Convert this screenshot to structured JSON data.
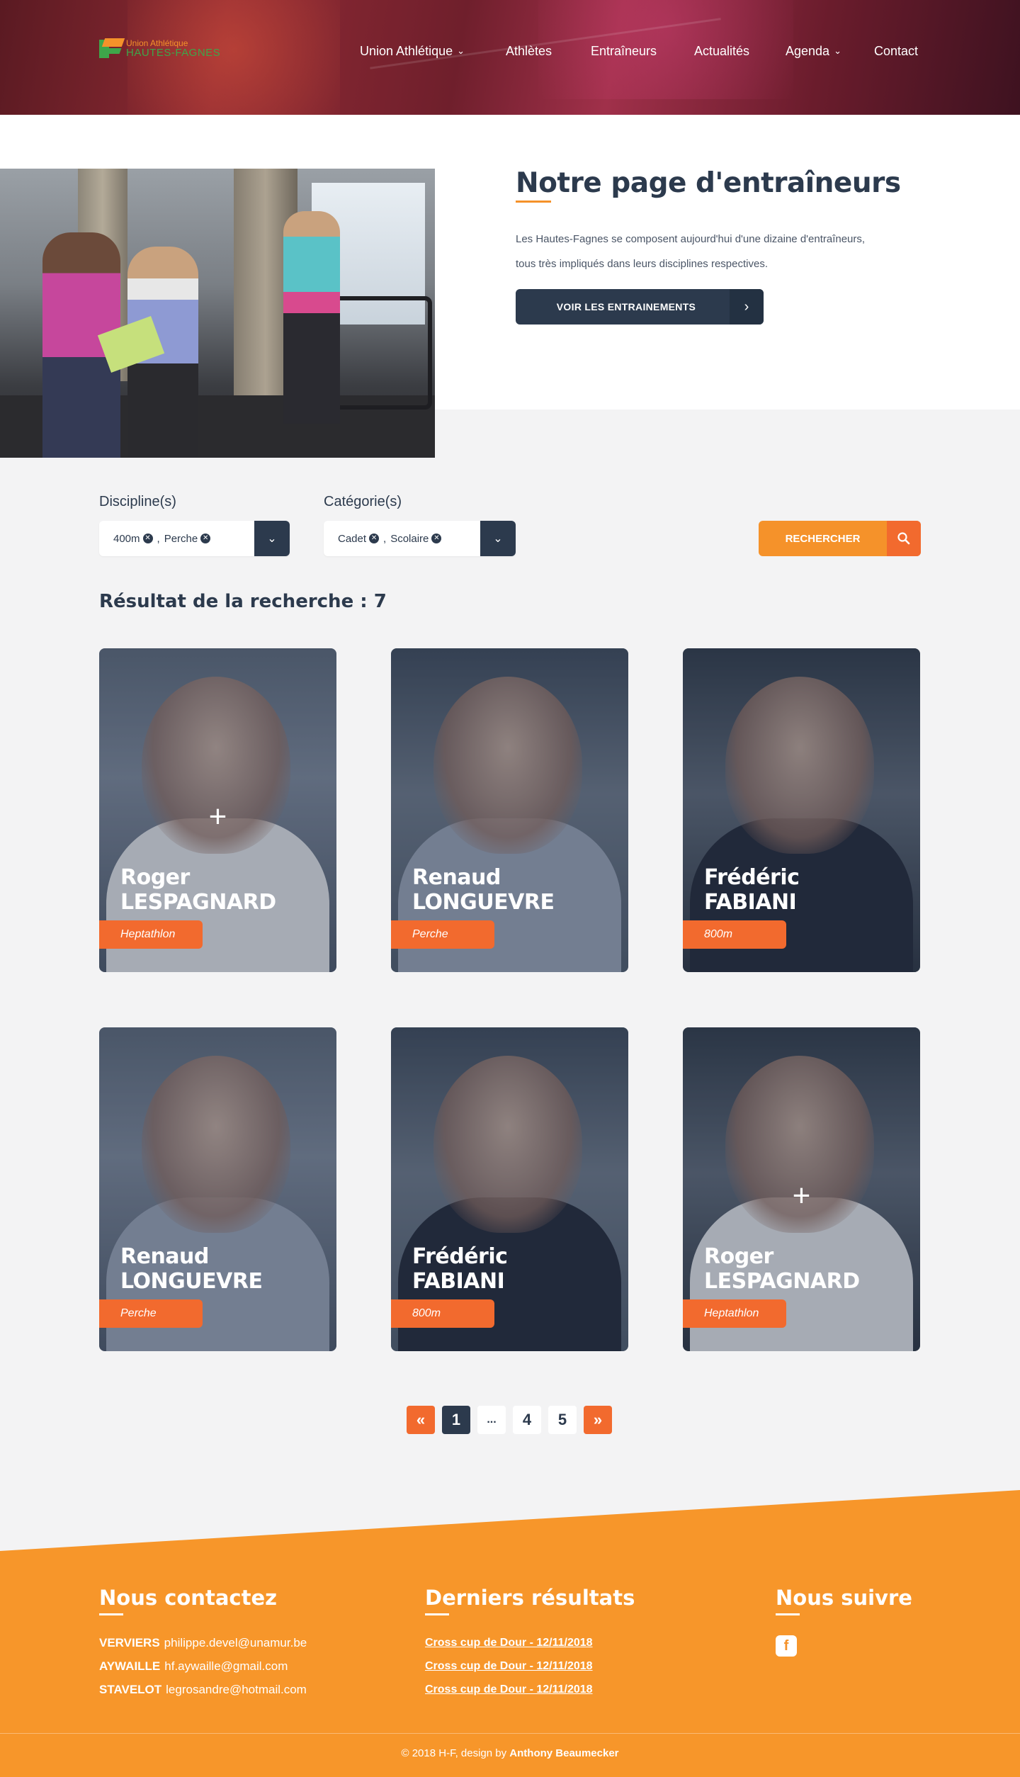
{
  "header": {
    "logo": {
      "line1": "Union Athlétique",
      "line2": "HAUTES-FAGNES"
    },
    "nav": [
      {
        "label": "Union Athlétique",
        "dropdown": true
      },
      {
        "label": "Athlètes",
        "dropdown": false
      },
      {
        "label": "Entraîneurs",
        "dropdown": false
      },
      {
        "label": "Actualités",
        "dropdown": false
      },
      {
        "label": "Agenda",
        "dropdown": true
      },
      {
        "label": "Contact",
        "dropdown": false
      }
    ]
  },
  "intro": {
    "title": "Notre page d'entraîneurs",
    "text_line1": "Les Hautes-Fagnes se composent aujourd'hui d'une dizaine d'entraîneurs,",
    "text_line2": "tous très impliqués dans leurs disciplines respectives.",
    "button_label": "VOIR LES  ENTRAINEMENTS"
  },
  "filters": {
    "discipline_label": "Discipline(s)",
    "discipline_tags": [
      "400m",
      "Perche"
    ],
    "category_label": "Catégorie(s)",
    "category_tags": [
      "Cadet",
      "Scolaire"
    ],
    "search_label": "RECHERCHER"
  },
  "results": {
    "label": "Résultat de la recherche : 7"
  },
  "cards": [
    {
      "first": "Roger",
      "last": "LESPAGNARD",
      "discipline": "Heptathlon",
      "hover": true,
      "shirt": "#e9e9ec"
    },
    {
      "first": "Renaud",
      "last": "LONGUEVRE",
      "discipline": "Perche",
      "hover": false,
      "shirt": "#9aa3b6"
    },
    {
      "first": "Frédéric",
      "last": "FABIANI",
      "discipline": "800m",
      "hover": false,
      "shirt": "#1d2130"
    },
    {
      "first": "Renaud",
      "last": "LONGUEVRE",
      "discipline": "Perche",
      "hover": false,
      "shirt": "#9aa3b6"
    },
    {
      "first": "Frédéric",
      "last": "FABIANI",
      "discipline": "800m",
      "hover": false,
      "shirt": "#1d2130"
    },
    {
      "first": "Roger",
      "last": "LESPAGNARD",
      "discipline": "Heptathlon",
      "hover": true,
      "shirt": "#e9e9ec"
    }
  ],
  "pagination": {
    "prev": "«",
    "pages": [
      "1",
      "...",
      "4",
      "5"
    ],
    "next": "»",
    "current": "1"
  },
  "footer": {
    "contact_title": "Nous contactez",
    "contacts": [
      {
        "city": "VERVIERS",
        "email": "philippe.devel@unamur.be"
      },
      {
        "city": "AYWAILLE",
        "email": "hf.aywaille@gmail.com"
      },
      {
        "city": "STAVELOT",
        "email": "legrosandre@hotmail.com"
      }
    ],
    "results_title": "Derniers résultats",
    "results_links": [
      "Cross cup de Dour - 12/11/2018",
      "Cross cup de Dour - 12/11/2018",
      "Cross cup de Dour - 12/11/2018"
    ],
    "follow_title": "Nous suivre",
    "copyright_prefix": "© 2018 H-F, design by",
    "copyright_author": "Anthony Beaumecker"
  },
  "colors": {
    "navy": "#2c3a4d",
    "orange": "#f5922a",
    "orange_dark": "#f26a2e",
    "background": "#f3f3f4"
  }
}
